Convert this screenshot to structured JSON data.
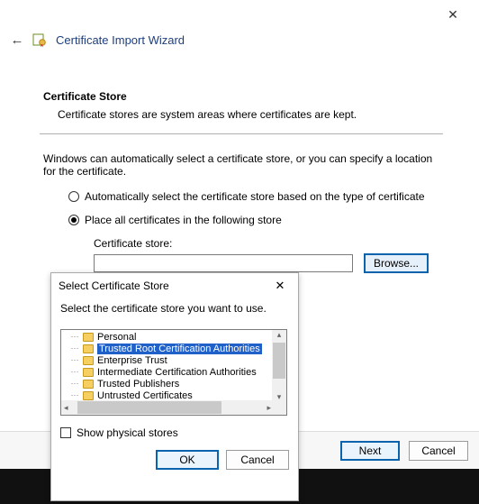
{
  "wizard": {
    "title": "Certificate Import Wizard",
    "close_glyph": "✕",
    "back_glyph": "←",
    "section_title": "Certificate Store",
    "section_desc": "Certificate stores are system areas where certificates are kept.",
    "explain": "Windows can automatically select a certificate store, or you can specify a location for the certificate.",
    "radio_auto": "Automatically select the certificate store based on the type of certificate",
    "radio_manual": "Place all certificates in the following store",
    "selected_radio": "manual",
    "store_label": "Certificate store:",
    "store_value": "",
    "browse_label": "Browse...",
    "next_label": "Next",
    "cancel_label": "Cancel"
  },
  "modal": {
    "title": "Select Certificate Store",
    "close_glyph": "✕",
    "desc": "Select the certificate store you want to use.",
    "items": [
      {
        "label": "Personal",
        "selected": false
      },
      {
        "label": "Trusted Root Certification Authorities",
        "selected": true
      },
      {
        "label": "Enterprise Trust",
        "selected": false
      },
      {
        "label": "Intermediate Certification Authorities",
        "selected": false
      },
      {
        "label": "Trusted Publishers",
        "selected": false
      },
      {
        "label": "Untrusted Certificates",
        "selected": false
      }
    ],
    "show_physical": "Show physical stores",
    "show_physical_checked": false,
    "ok_label": "OK",
    "cancel_label": "Cancel"
  }
}
